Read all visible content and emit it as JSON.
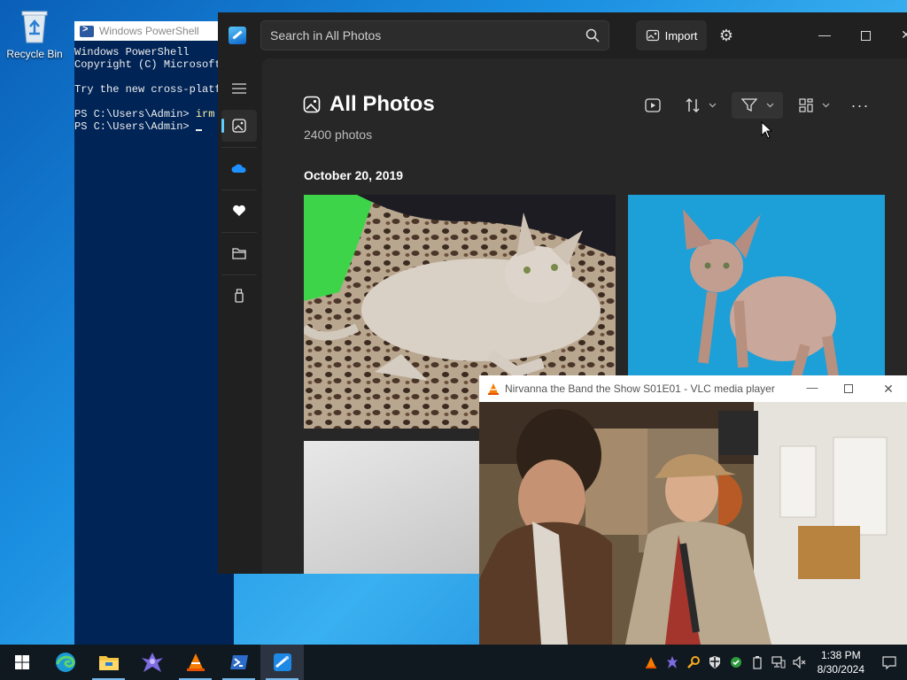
{
  "desktop": {
    "recycle_bin_label": "Recycle Bin"
  },
  "powershell": {
    "title": "Windows PowerShell",
    "lines": [
      "Windows PowerShell",
      "Copyright (C) Microsoft",
      "",
      "Try the new cross-platf",
      ""
    ],
    "prompt1": "PS C:\\Users\\Admin> ",
    "cmd1": "irm",
    "prompt2": "PS C:\\Users\\Admin> "
  },
  "photos": {
    "search_placeholder": "Search in All Photos",
    "import_label": "Import",
    "page_title": "All Photos",
    "photo_count": "2400 photos",
    "date_group": "October 20, 2019",
    "sidebar_items": [
      "photos-icon",
      "onedrive-icon",
      "favorites-icon",
      "folders-icon",
      "device-icon"
    ],
    "accent": "#60cdff"
  },
  "vlc": {
    "title": "Nirvanna the Band the Show S01E01 - VLC media player"
  },
  "taskbar": {
    "apps": [
      "start-icon",
      "edge-icon",
      "file-explorer-icon",
      "app-icon",
      "vlc-icon",
      "powershell-icon",
      "photos-icon"
    ],
    "time": "1:38 PM",
    "date": "8/30/2024"
  }
}
